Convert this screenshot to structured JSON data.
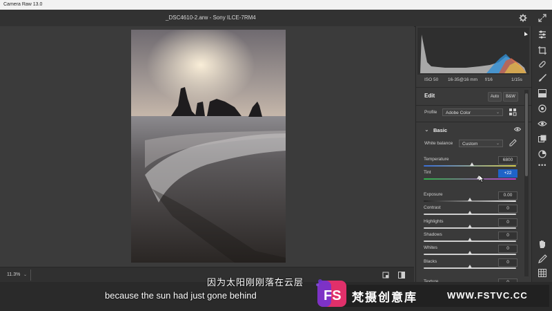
{
  "window": {
    "title": "Camera Raw 13.0"
  },
  "topbar": {
    "filename": "_DSC4610-2.arw  -  Sony ILCE-7RM4"
  },
  "statusbar": {
    "zoom": "11.3%"
  },
  "camera_info": {
    "iso": "ISO 50",
    "lens": "16-35@16 mm",
    "aperture": "f/16",
    "shutter": "1/15s"
  },
  "edit": {
    "title": "Edit",
    "auto_label": "Auto",
    "bw_label": "B&W",
    "profile_label": "Profile",
    "profile_value": "Adobe Color"
  },
  "basic": {
    "title": "Basic",
    "white_balance_label": "White balance",
    "white_balance_value": "Custom",
    "sliders": [
      {
        "label": "Temperature",
        "value": "6800",
        "position": 0.52
      },
      {
        "label": "Tint",
        "value": "+22",
        "position": 0.6,
        "active": true
      },
      {
        "label": "Exposure",
        "value": "0.00",
        "position": 0.5
      },
      {
        "label": "Contrast",
        "value": "0",
        "position": 0.5
      },
      {
        "label": "Highlights",
        "value": "0",
        "position": 0.5
      },
      {
        "label": "Shadows",
        "value": "0",
        "position": 0.5
      },
      {
        "label": "Whites",
        "value": "0",
        "position": 0.5
      },
      {
        "label": "Blacks",
        "value": "0",
        "position": 0.5
      },
      {
        "label": "Texture",
        "value": "0",
        "position": 0.5
      }
    ]
  },
  "subtitles": {
    "chinese": "因为太阳刚刚落在云层",
    "english": "because the sun had just gone behind"
  },
  "watermark": {
    "logo": "FS",
    "chinese": "梵摄创意库",
    "url": "WWW.FSTVC.CC"
  },
  "colors": {
    "active_value_bg": "#1e63c8",
    "panel_bg": "#3a3a3a",
    "accent_pink": "#e0306a",
    "accent_purple": "#6b33d6"
  }
}
